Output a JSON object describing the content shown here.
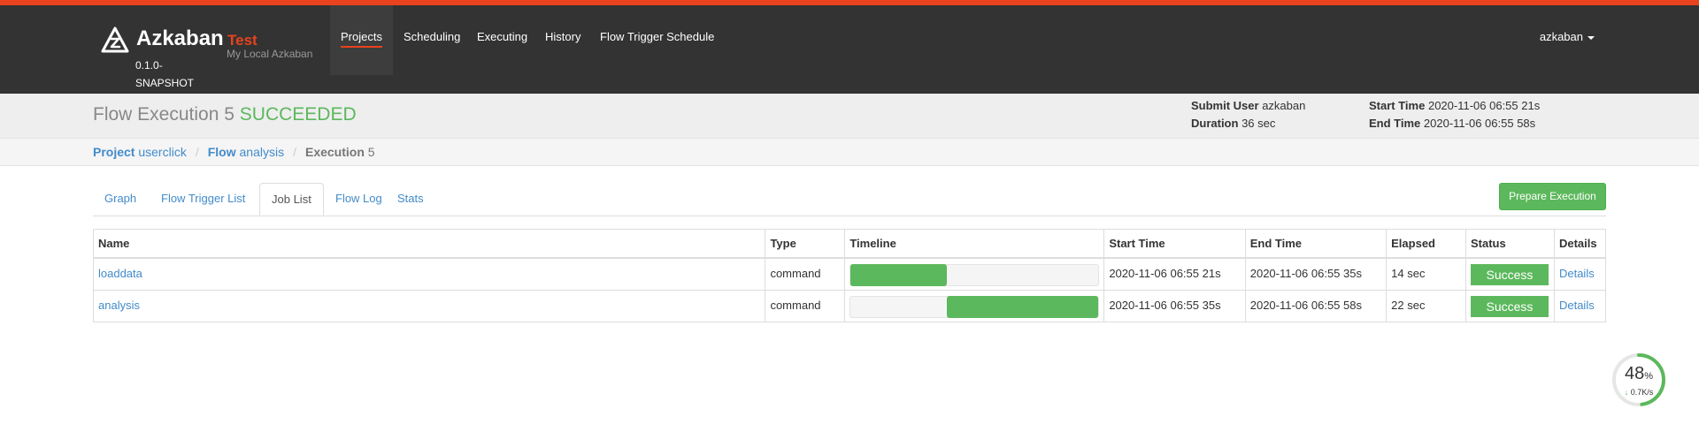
{
  "brand": {
    "name": "Azkaban",
    "version": "0.1.0-SNAPSHOT",
    "env_name": "Test",
    "env_desc": "My Local Azkaban"
  },
  "nav": [
    "Projects",
    "Scheduling",
    "Executing",
    "History",
    "Flow Trigger Schedule"
  ],
  "user": "azkaban",
  "flow": {
    "title_prefix": "Flow Execution 5",
    "status": "SUCCEEDED",
    "submit_user_label": "Submit User",
    "submit_user": "azkaban",
    "duration_label": "Duration",
    "duration": "36 sec",
    "start_label": "Start Time",
    "start_time": "2020-11-06 06:55 21s",
    "end_label": "End Time",
    "end_time": "2020-11-06 06:55 58s"
  },
  "breadcrumb": {
    "project_label": "Project",
    "project": "userclick",
    "flow_label": "Flow",
    "flow": "analysis",
    "execution_label": "Execution",
    "execution": "5"
  },
  "tabs": [
    "Graph",
    "Flow Trigger List",
    "Job List",
    "Flow Log",
    "Stats"
  ],
  "active_tab": "Job List",
  "prepare_button": "Prepare Execution",
  "table": {
    "headers": [
      "Name",
      "Type",
      "Timeline",
      "Start Time",
      "End Time",
      "Elapsed",
      "Status",
      "Details"
    ],
    "rows": [
      {
        "name": "loaddata",
        "type": "command",
        "timeline_start": 0.0,
        "timeline_end": 0.389,
        "start": "2020-11-06 06:55 21s",
        "end": "2020-11-06 06:55 35s",
        "elapsed": "14 sec",
        "status": "Success",
        "details": "Details"
      },
      {
        "name": "analysis",
        "type": "command",
        "timeline_start": 0.389,
        "timeline_end": 1.0,
        "start": "2020-11-06 06:55 35s",
        "end": "2020-11-06 06:55 58s",
        "elapsed": "22 sec",
        "status": "Success",
        "details": "Details"
      }
    ]
  },
  "widget": {
    "percent": "48",
    "percent_sign": "%",
    "speed": "0.7K/s",
    "progress": 0.48
  },
  "colors": {
    "accent": "#e8431e",
    "success": "#5cb85c",
    "link": "#428bca",
    "navbar": "#333333"
  }
}
